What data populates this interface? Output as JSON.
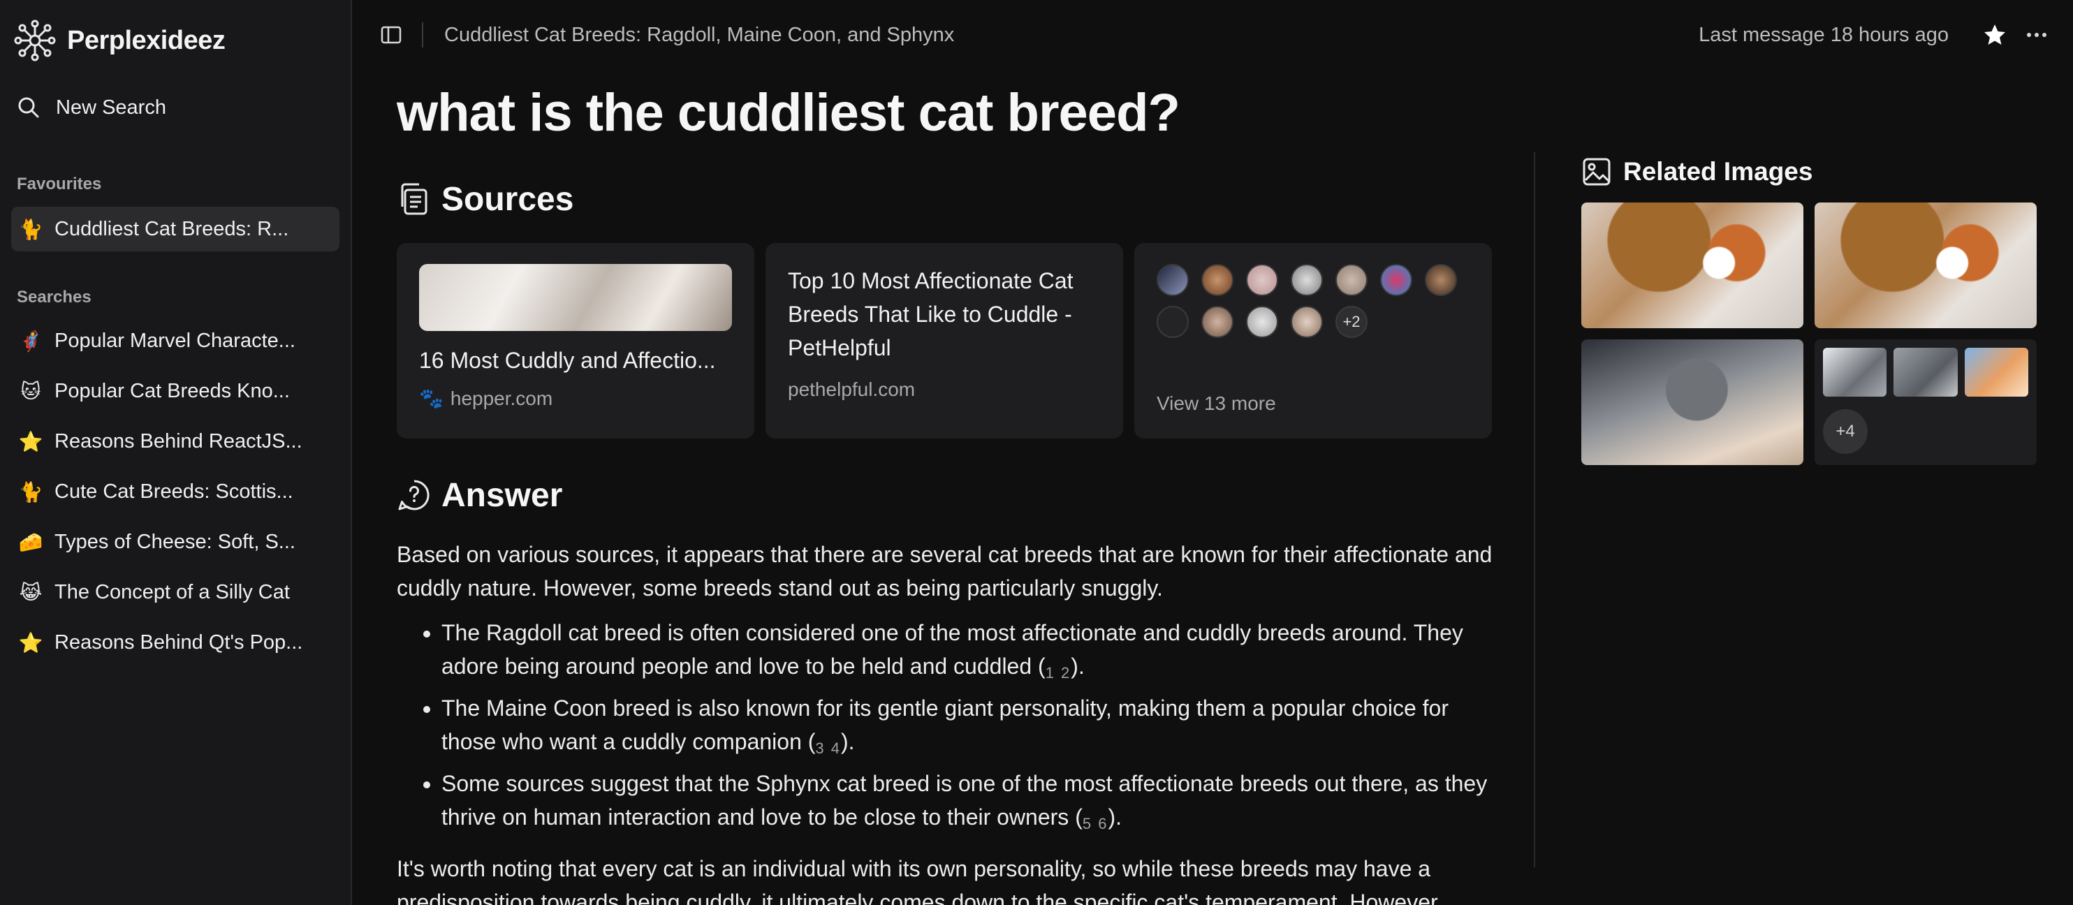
{
  "brand": {
    "name": "Perplexideez"
  },
  "sidebar": {
    "new_search": "New Search",
    "favourites_label": "Favourites",
    "favourites": [
      {
        "emoji": "🐈",
        "label": "Cuddliest Cat Breeds: R..."
      }
    ],
    "searches_label": "Searches",
    "searches": [
      {
        "emoji": "🦸",
        "label": "Popular Marvel Characte..."
      },
      {
        "emoji": "🐱",
        "label": "Popular Cat Breeds Kno..."
      },
      {
        "emoji": "⭐",
        "label": "Reasons Behind ReactJS..."
      },
      {
        "emoji": "🐈",
        "label": "Cute Cat Breeds: Scottis..."
      },
      {
        "emoji": "🧀",
        "label": "Types of Cheese: Soft, S..."
      },
      {
        "emoji": "😹",
        "label": "The Concept of a Silly Cat"
      },
      {
        "emoji": "⭐",
        "label": "Reasons Behind Qt's Pop..."
      }
    ]
  },
  "topbar": {
    "breadcrumb": "Cuddliest Cat Breeds: Ragdoll, Maine Coon, and Sphynx",
    "last_message": "Last message 18 hours ago"
  },
  "question": "what is the cuddliest cat breed?",
  "sources": {
    "heading": "Sources",
    "cards": [
      {
        "title": "16 Most Cuddly and Affectio...",
        "domain": "hepper.com"
      },
      {
        "title": "Top 10 Most Affectionate Cat Breeds That Like to Cuddle - PetHelpful",
        "domain": "pethelpful.com"
      }
    ],
    "more_badge": "+2",
    "view_more": "View 13 more"
  },
  "answer": {
    "heading": "Answer",
    "intro": "Based on various sources, it appears that there are several cat breeds that are known for their affectionate and cuddly nature. However, some breeds stand out as being particularly snuggly.",
    "bullets": [
      {
        "text": "The Ragdoll cat breed is often considered one of the most affectionate and cuddly breeds around. They adore being around people and love to be held and cuddled (",
        "cite": "1 2",
        "close": ")."
      },
      {
        "text": "The Maine Coon breed is also known for its gentle giant personality, making them a popular choice for those who want a cuddly companion (",
        "cite": "3 4",
        "close": ")."
      },
      {
        "text": "Some sources suggest that the Sphynx cat breed is one of the most affectionate breeds out there, as they thrive on human interaction and love to be close to their owners (",
        "cite": "5 6",
        "close": ")."
      }
    ],
    "closing": "It's worth noting that every cat is an individual with its own personality, so while these breeds may have a predisposition towards being cuddly, it ultimately comes down to the specific cat's temperament. However,"
  },
  "related": {
    "heading": "Related Images",
    "more_badge": "+4"
  }
}
